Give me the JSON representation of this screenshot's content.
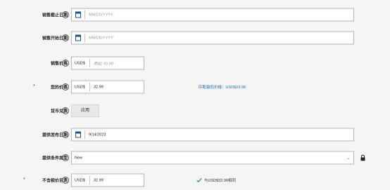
{
  "help_glyph": "?",
  "rows": {
    "sale_end": {
      "label": "销售截止日期",
      "placeholder": "MM/DD/YYYY"
    },
    "sale_start": {
      "label": "销售开始日期",
      "placeholder": "MM/DD/YYYY"
    },
    "sale_price": {
      "label": "销售价格",
      "currency": "USD$",
      "placeholder": "例如: 50.00"
    },
    "your_price": {
      "label": "您的价格",
      "currency": "USD$",
      "value": "32.99",
      "note": "匹配最低价格：USD$23.98"
    },
    "currency_convert": {
      "label": "货币兑换",
      "button_label": "应用"
    },
    "release_date": {
      "label": "提供发布日期",
      "value": "9/14/2023"
    },
    "condition_type": {
      "label": "提供条件类型",
      "selected": "New"
    },
    "list_price": {
      "label": "不含税价目表",
      "currency": "USD$",
      "value": "32.99",
      "note": "与USD$32.99相同"
    }
  },
  "colors": {
    "note_blue": "#2e6da4",
    "check_green": "#2f8a3b",
    "calendar_blue": "#1f4f83"
  },
  "icons": [
    "help-icon",
    "calendar-icon",
    "chevron-down-icon",
    "lock-icon",
    "checkmark-icon"
  ]
}
